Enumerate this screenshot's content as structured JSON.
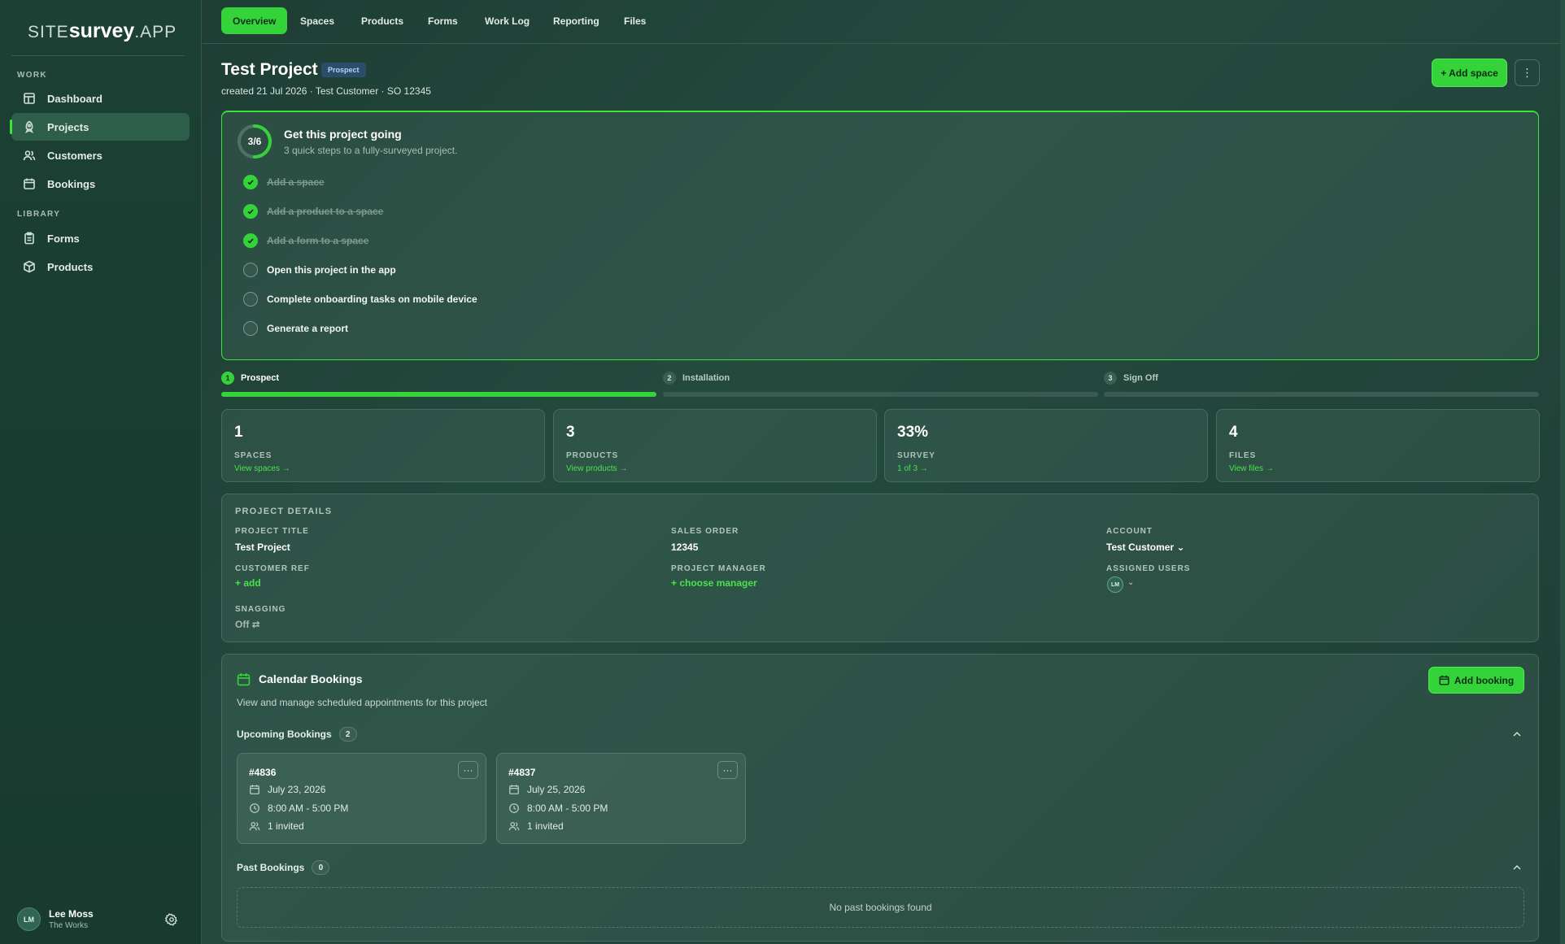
{
  "brand": {
    "pre": "SITE",
    "mid": "survey",
    "post": ".APP"
  },
  "sidebar": {
    "sections": {
      "work": "WORK",
      "library": "LIBRARY"
    },
    "items": [
      {
        "label": "Dashboard",
        "icon": "dashboard-icon"
      },
      {
        "label": "Projects",
        "icon": "rocket-icon",
        "active": true
      },
      {
        "label": "Customers",
        "icon": "users-icon"
      },
      {
        "label": "Bookings",
        "icon": "calendar-icon"
      },
      {
        "label": "Forms",
        "icon": "clipboard-icon"
      },
      {
        "label": "Products",
        "icon": "box-icon"
      }
    ],
    "user": {
      "initials": "LM",
      "name": "Lee Moss",
      "org": "The Works"
    }
  },
  "tabs": [
    "Overview",
    "Spaces",
    "Products",
    "Forms",
    "Work Log",
    "Reporting",
    "Files"
  ],
  "header": {
    "title": "Test Project",
    "badge": "Prospect",
    "subtitle": "created 21 Jul 2026 · Test Customer · SO 12345",
    "add_space": "+ Add space",
    "more": "⋮"
  },
  "onboarding": {
    "progress_label": "3/6",
    "progress_fraction": 0.5,
    "title": "Get this project going",
    "subtitle": "3 quick steps to a fully-surveyed project.",
    "steps": [
      {
        "label": "Add a space",
        "done": true
      },
      {
        "label": "Add a product to a space",
        "done": true
      },
      {
        "label": "Add a form to a space",
        "done": true
      },
      {
        "label": "Open this project in the app",
        "done": false
      },
      {
        "label": "Complete onboarding tasks on mobile device",
        "done": false
      },
      {
        "label": "Generate a report",
        "done": false
      }
    ]
  },
  "stages": [
    {
      "num": "1",
      "label": "Prospect",
      "active": true
    },
    {
      "num": "2",
      "label": "Installation",
      "active": false
    },
    {
      "num": "3",
      "label": "Sign Off",
      "active": false
    }
  ],
  "stats": [
    {
      "value": "1",
      "label": "SPACES",
      "link": "View spaces →"
    },
    {
      "value": "3",
      "label": "PRODUCTS",
      "link": "View products →"
    },
    {
      "value": "33%",
      "label": "SURVEY",
      "link": "1 of 3 →"
    },
    {
      "value": "4",
      "label": "FILES",
      "link": "View files →"
    }
  ],
  "details": {
    "section_title": "PROJECT DETAILS",
    "project_title_label": "PROJECT TITLE",
    "project_title_value": "Test Project",
    "sales_order_label": "SALES ORDER",
    "sales_order_value": "12345",
    "account_label": "ACCOUNT",
    "account_value": "Test Customer ⌄",
    "customer_ref_label": "CUSTOMER REF",
    "customer_ref_action": "+ add",
    "project_manager_label": "PROJECT MANAGER",
    "project_manager_action": "+ choose manager",
    "assigned_users_label": "ASSIGNED USERS",
    "assigned_user_initials": "LM",
    "assigned_caret": "⌄",
    "snagging_label": "SNAGGING",
    "snagging_value": "Off ⇄"
  },
  "calendar": {
    "title": "Calendar Bookings",
    "subtitle": "View and manage scheduled appointments for this project",
    "add_booking": "Add booking",
    "upcoming_label": "Upcoming Bookings",
    "upcoming_count": "2",
    "past_label": "Past Bookings",
    "past_count": "0",
    "empty_past": "No past bookings found",
    "bookings": [
      {
        "id": "#4836",
        "date": "July 23, 2026",
        "time": "8:00 AM - 5:00 PM",
        "invited": "1 invited"
      },
      {
        "id": "#4837",
        "date": "July 25, 2026",
        "time": "8:00 AM - 5:00 PM",
        "invited": "1 invited"
      }
    ]
  },
  "colors": {
    "accent": "#35d33a",
    "background": "#244a3e",
    "badge": "#2a4e6a"
  }
}
